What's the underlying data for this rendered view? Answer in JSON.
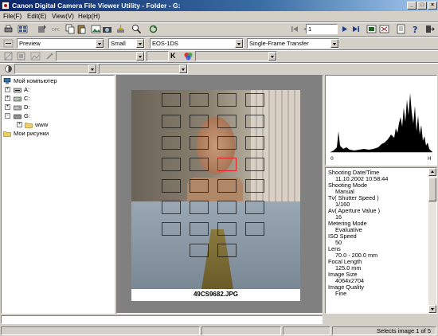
{
  "window": {
    "title": "Canon Digital Camera File Viewer Utility - Folder - G:",
    "controls": [
      "_",
      "□",
      "×"
    ]
  },
  "menu": [
    "File(F)",
    "Edit(E)",
    "View(V)",
    "Help(H)"
  ],
  "toolbar": {
    "page_number": "1",
    "view_mode": "Preview",
    "thumb_size": "Small",
    "camera_model": "EOS-1DS",
    "transfer_mode": "Single-Frame Transfer",
    "k_label": "K"
  },
  "tree": {
    "root": "Мой компьютер",
    "drives": [
      "A:",
      "C:",
      "D:",
      "G:"
    ],
    "subfolder": "www",
    "pictures": "Мои рисунки"
  },
  "image": {
    "filename": "49CS9682.JPG"
  },
  "histogram": {
    "min_label": "0",
    "max_label": "H"
  },
  "info": [
    {
      "label": "Shooting Date/Time",
      "value": "11.10.2002 10:58:44"
    },
    {
      "label": "Shooting Mode",
      "value": "Manual"
    },
    {
      "label": "Tv( Shutter Speed )",
      "value": "1/160"
    },
    {
      "label": "Av( Aperture Value )",
      "value": "16"
    },
    {
      "label": "Metering Mode",
      "value": "Evaluative"
    },
    {
      "label": "ISO Speed",
      "value": "50"
    },
    {
      "label": "Lens",
      "value": "70.0 - 200.0 mm"
    },
    {
      "label": "Focal Length",
      "value": "125.0 mm"
    },
    {
      "label": "Image Size",
      "value": "4064x2704"
    },
    {
      "label": "Image Quality",
      "value": "Fine"
    }
  ],
  "status": {
    "message": "Selects image 1 of 5"
  },
  "colors": {
    "titlebar_start": "#0a246a",
    "titlebar_end": "#a6caf0",
    "window_bg": "#d4d0c8",
    "selection": "#0a246a",
    "af_active": "#e02020"
  }
}
